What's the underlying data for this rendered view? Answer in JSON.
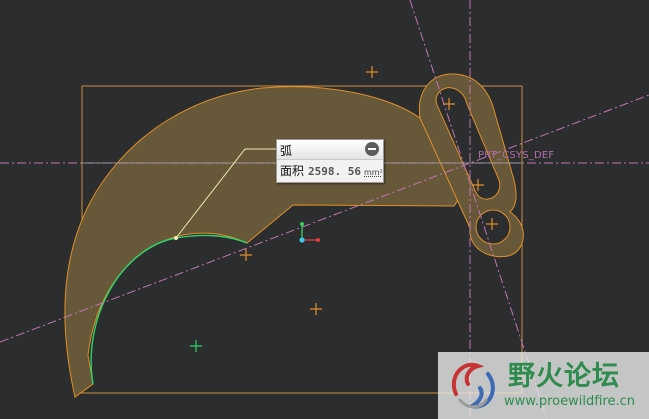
{
  "tooltip": {
    "title": "弧",
    "area_label": "面积",
    "area_value": "2598. 56",
    "area_unit": "mm²"
  },
  "csys_label": "PRT_CSYS_DEF",
  "watermark": {
    "site_name": "野火论坛",
    "url": "www.proewildfire.cn"
  },
  "colors": {
    "background": "#2b2d2f",
    "part_fill": "#665838",
    "part_edge": "#e0902a",
    "selected_arc": "#2fd36b",
    "centerline": "#c277b2",
    "bounding_box": "#d2903f",
    "leader_line": "#f1f0b6"
  },
  "icons": {
    "tooltip_collapse": "minus-circle-icon",
    "watermark_logo": "fire-swirl-logo",
    "triad": "coordinate-triad-icon"
  }
}
